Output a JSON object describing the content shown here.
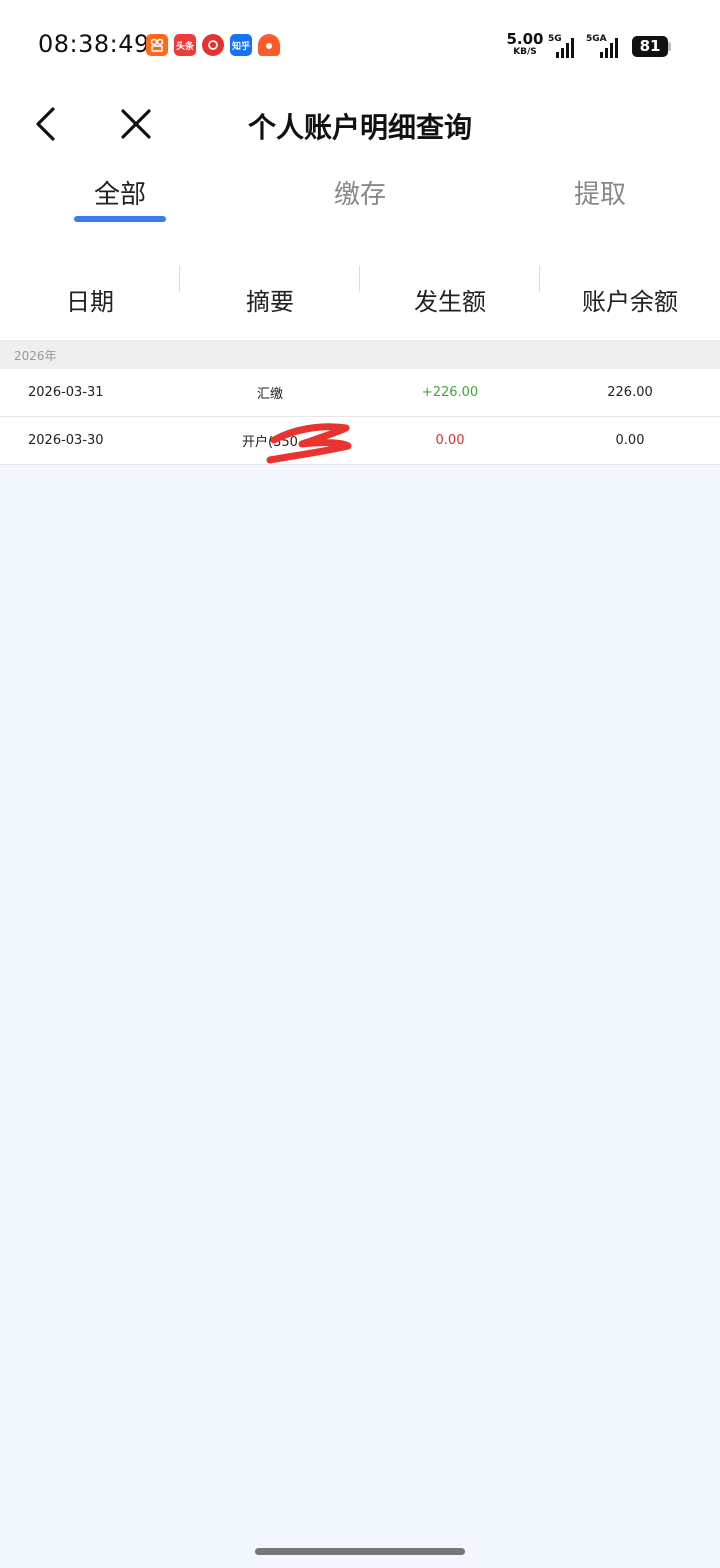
{
  "status_bar": {
    "time": "08:38:49",
    "notifications": [
      {
        "icon": "kuaishou-icon",
        "text": ""
      },
      {
        "icon": "toutiao-icon",
        "text": "头条"
      },
      {
        "icon": "video-app-icon",
        "text": ""
      },
      {
        "icon": "zhihu-icon",
        "text": "知乎"
      },
      {
        "icon": "alarm-app-icon",
        "text": ""
      }
    ],
    "net_speed_value": "5.00",
    "net_speed_unit": "KB/S",
    "signal1_label": "5G",
    "signal2_label": "5GA",
    "battery": "81"
  },
  "header": {
    "title": "个人账户明细查询"
  },
  "tabs": [
    {
      "label": "全部",
      "active": true
    },
    {
      "label": "缴存",
      "active": false
    },
    {
      "label": "提取",
      "active": false
    }
  ],
  "columns": [
    "日期",
    "摘要",
    "发生额",
    "账户余额"
  ],
  "groups": [
    {
      "year": "2026年",
      "rows": [
        {
          "date": "2026-03-31",
          "summary": "汇缴",
          "amount": "+226.00",
          "balance": "226.00",
          "amount_color": "#43a83a"
        },
        {
          "date": "2026-03-30",
          "summary": "开户(350",
          "amount": "0.00",
          "balance": "0.00",
          "amount_color": "#e03030"
        }
      ]
    }
  ],
  "colors": {
    "accent": "#3a7cf0",
    "positive": "#43a83a",
    "negative": "#e03030",
    "background": "#f2f6fd"
  }
}
